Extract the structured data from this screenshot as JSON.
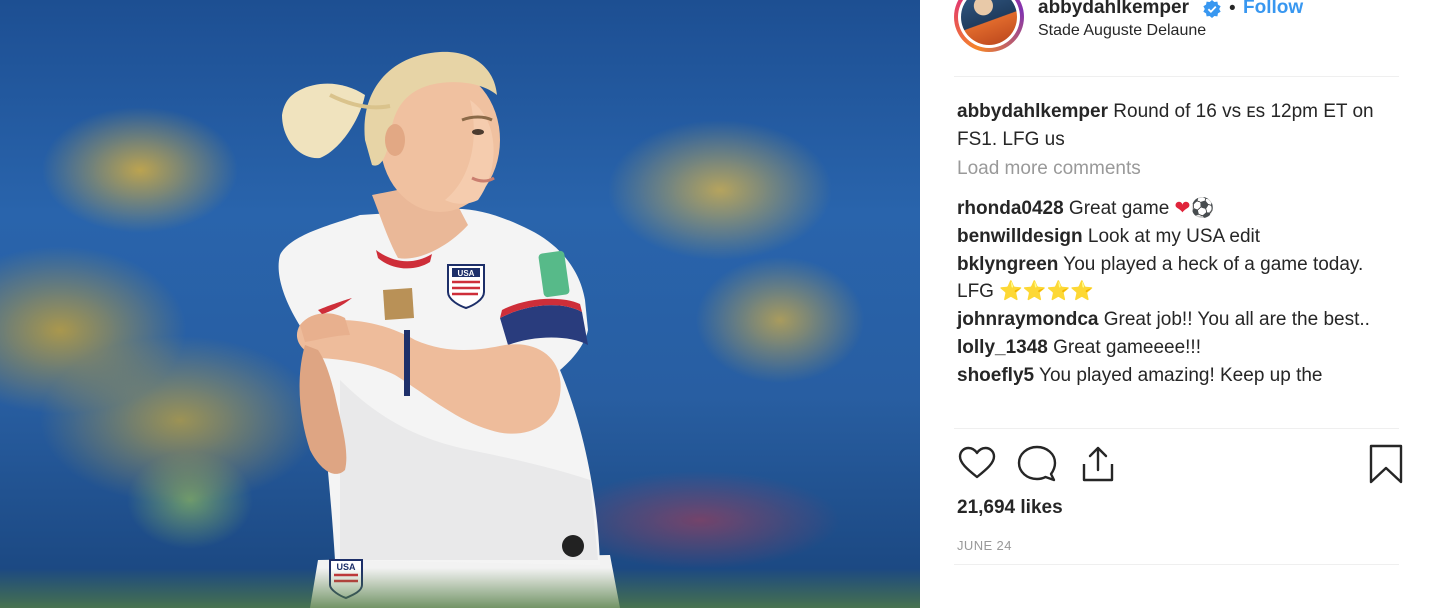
{
  "post": {
    "username": "abbydahlkemper",
    "follow_label": "Follow",
    "separator": "•",
    "location": "Stade Auguste Delaune",
    "caption_user": "abbydahlkemper",
    "caption_text": " Round of 16 vs ᴇs 12pm ET on FS1. LFG us",
    "load_more": "Load more comments",
    "comments": [
      {
        "user": "rhonda0428",
        "text": " Great game "
      },
      {
        "user": "benwilldesign",
        "text": " Look at my USA edit"
      },
      {
        "user": "bklyngreen",
        "text": " You played a heck of a game today. LFG "
      },
      {
        "user": "johnraymondca",
        "text": " Great job!! You all are the best.."
      },
      {
        "user": "lolly_1348",
        "text": " Great gameeee!!!"
      },
      {
        "user": "shoefly5",
        "text": " You played amazing! Keep up the"
      }
    ],
    "comment_emojis": {
      "heart": "❤",
      "soccer": "⚽",
      "star": "⭐"
    },
    "likes": "21,694 likes",
    "date": "JUNE 24"
  },
  "icons": {
    "verified": "verified-badge-icon",
    "like": "heart-icon",
    "comment": "comment-icon",
    "share": "share-icon",
    "save": "bookmark-icon"
  },
  "colors": {
    "link": "#3897f0",
    "text": "#262626",
    "muted": "#999999",
    "divider": "#efefef"
  },
  "photo": {
    "jersey_text": "USA"
  }
}
